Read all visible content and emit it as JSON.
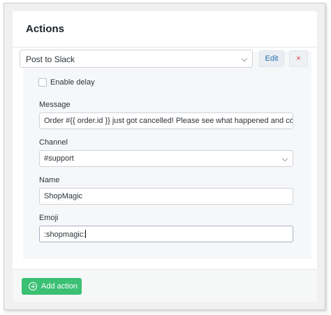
{
  "section": {
    "title": "Actions"
  },
  "action": {
    "type_selected": "Post to Slack",
    "edit_label": "Edit",
    "remove_label": "×",
    "enable_delay_label": "Enable delay",
    "fields": {
      "message": {
        "label": "Message",
        "value": "Order #{{ order.id }} just got cancelled! Please see what happened and contact t"
      },
      "channel": {
        "label": "Channel",
        "value": "#support"
      },
      "name": {
        "label": "Name",
        "value": "ShopMagic"
      },
      "emoji": {
        "label": "Emoji",
        "value": ":shopmagic:"
      }
    }
  },
  "footer": {
    "add_action_label": "Add action"
  },
  "icons": {
    "add": "plus-circle-icon",
    "dropdown": "chevron-down-icon"
  }
}
